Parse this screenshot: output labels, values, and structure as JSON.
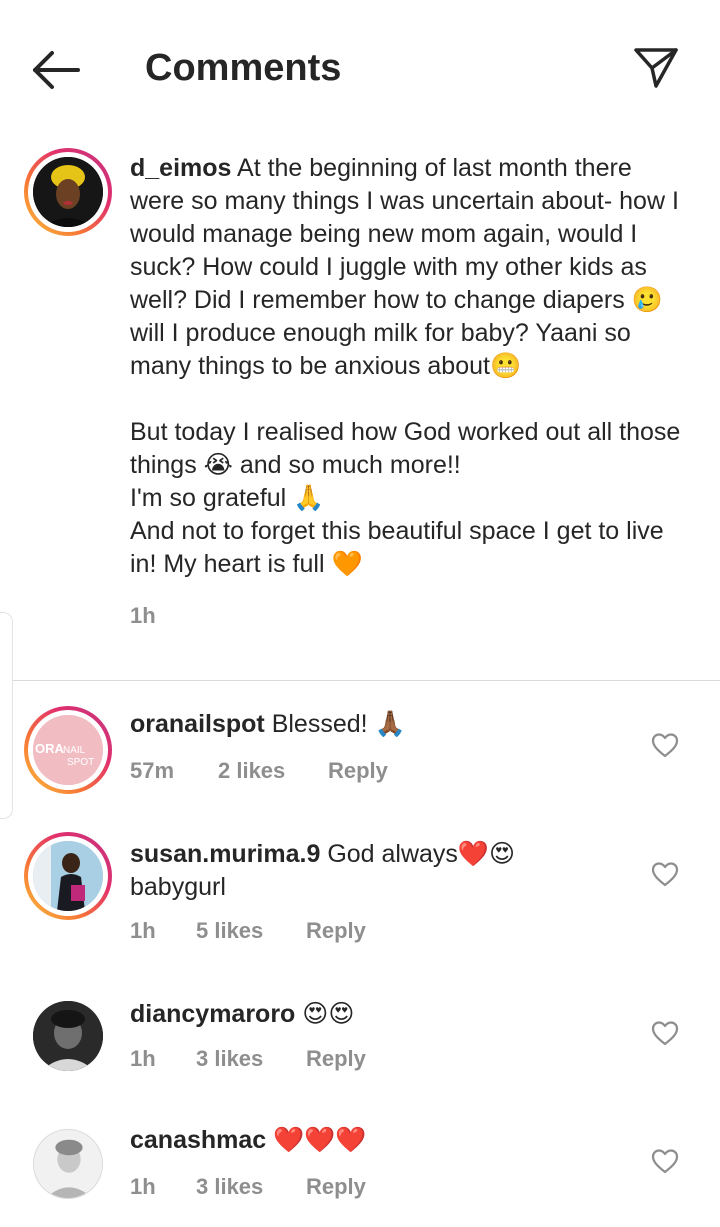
{
  "header": {
    "title": "Comments"
  },
  "caption": {
    "username": "d_eimos",
    "text": "At the beginning of last month there were so many things I was uncertain about- how I would manage being new mom again, would I suck? How could I juggle with my other kids as well? Did I remember how to change diapers 🥲 will I produce enough milk for baby? Yaani so many things to be anxious about😬\n\nBut today I realised how God worked out all those things 😭 and so much more!!\nI'm so grateful 🙏\nAnd not to forget this beautiful space I get to live in! My heart is full 🧡",
    "time": "1h"
  },
  "comments": [
    {
      "username": "oranailspot",
      "text": "Blessed! 🙏🏾",
      "time": "57m",
      "likes": "2 likes",
      "reply": "Reply",
      "avatar_text": "ORANAIL SPOT"
    },
    {
      "username": "susan.murima.9",
      "text": "God always❤️😍 babygurl",
      "time": "1h",
      "likes": "5 likes",
      "reply": "Reply"
    },
    {
      "username": "diancymaroro",
      "text": "😍😍",
      "time": "1h",
      "likes": "3 likes",
      "reply": "Reply"
    },
    {
      "username": "canashmac",
      "text": "❤️❤️❤️",
      "time": "1h",
      "likes": "3 likes",
      "reply": "Reply"
    }
  ],
  "icons": {
    "back": "arrow-left-icon",
    "share": "paper-plane-icon",
    "like": "heart-outline-icon"
  },
  "colors": {
    "text": "#262626",
    "muted": "#8e8e8e",
    "divider": "#dbdbdb",
    "ring_start": "#f9c23c",
    "ring_end": "#c13584"
  }
}
